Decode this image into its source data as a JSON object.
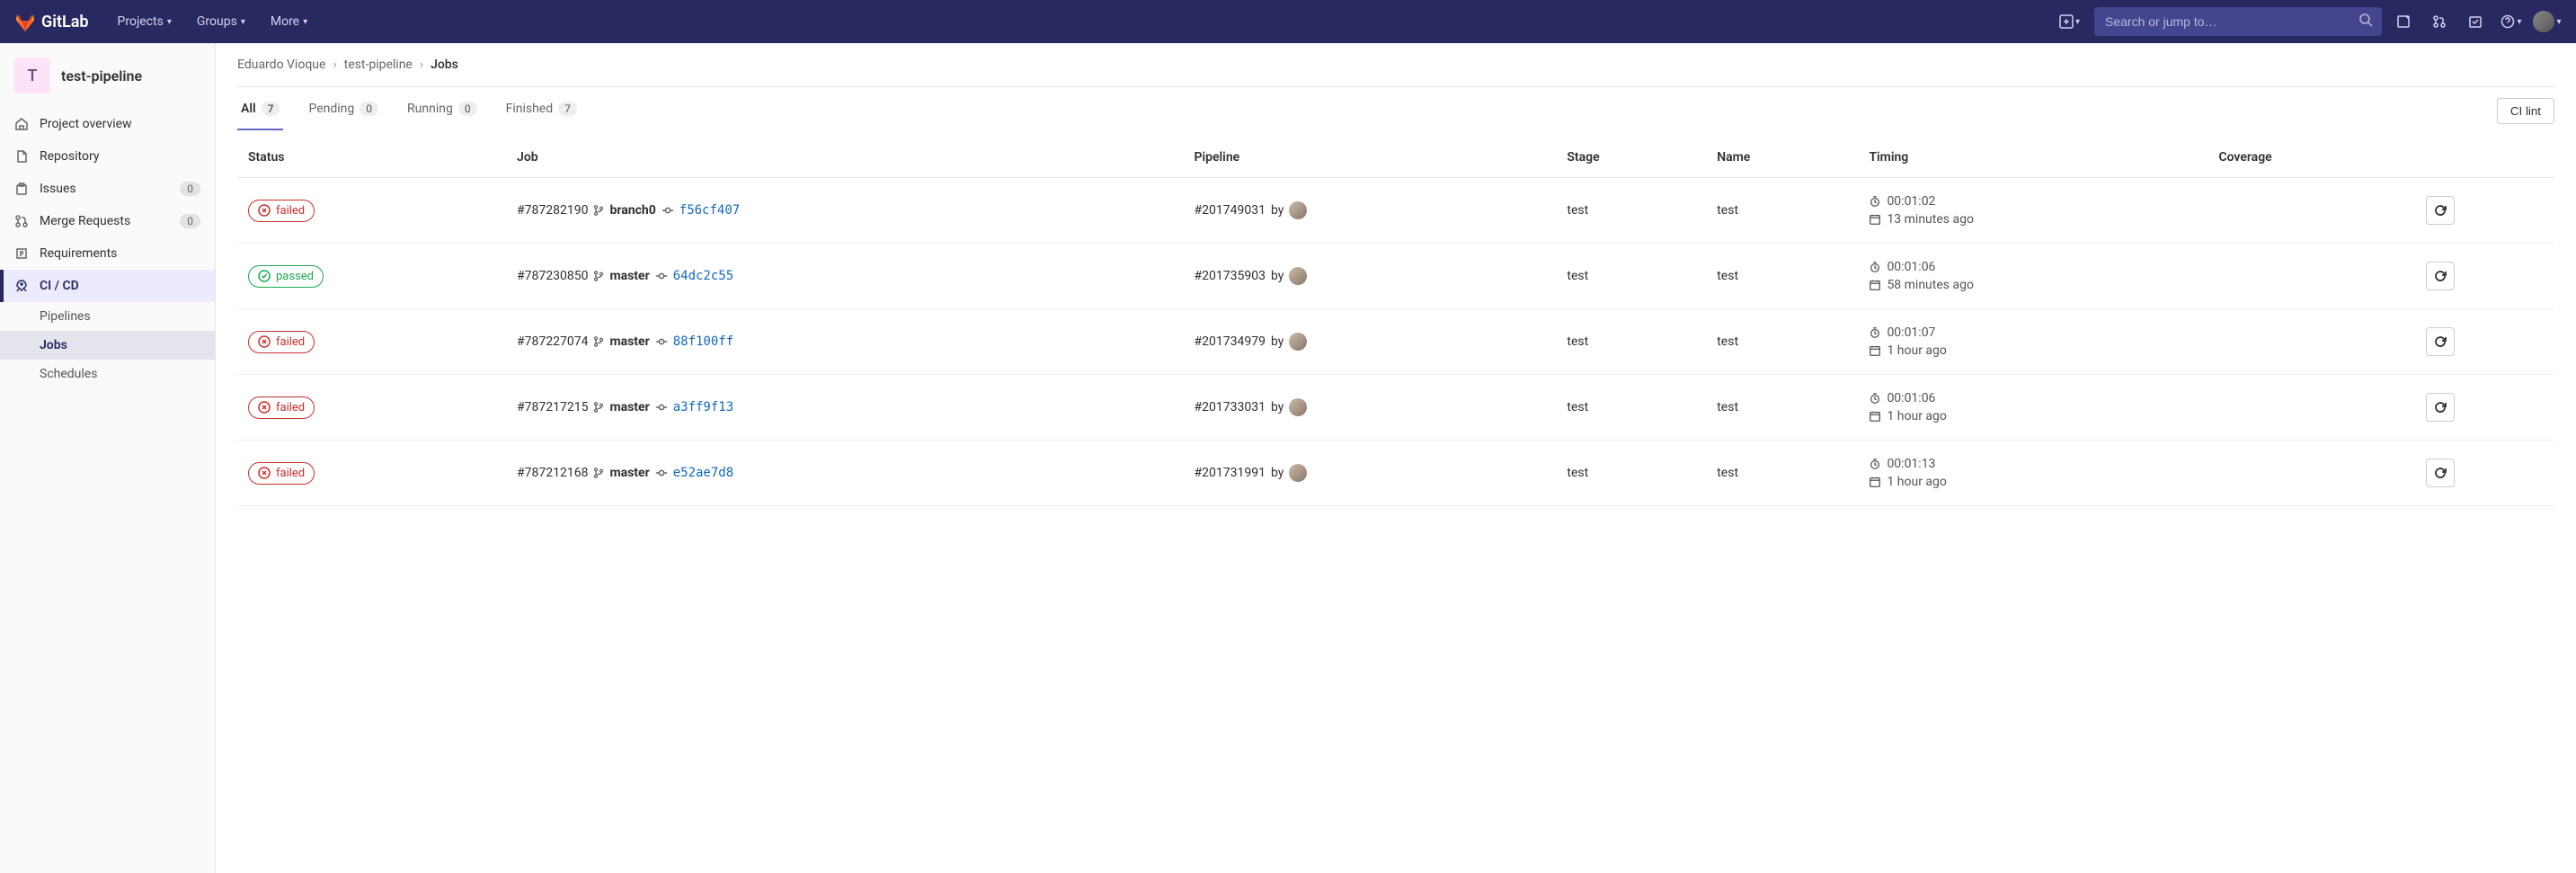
{
  "navbar": {
    "brand": "GitLab",
    "items": [
      "Projects",
      "Groups",
      "More"
    ],
    "search_placeholder": "Search or jump to…"
  },
  "sidebar": {
    "project_initial": "T",
    "project_name": "test-pipeline",
    "items": [
      {
        "label": "Project overview",
        "icon": "home"
      },
      {
        "label": "Repository",
        "icon": "doc"
      },
      {
        "label": "Issues",
        "icon": "issue",
        "badge": "0"
      },
      {
        "label": "Merge Requests",
        "icon": "merge",
        "badge": "0"
      },
      {
        "label": "Requirements",
        "icon": "req"
      },
      {
        "label": "CI / CD",
        "icon": "rocket",
        "active": true
      }
    ],
    "sub": [
      {
        "label": "Pipelines"
      },
      {
        "label": "Jobs",
        "active": true
      },
      {
        "label": "Schedules"
      }
    ]
  },
  "breadcrumb": {
    "owner": "Eduardo Vioque",
    "project": "test-pipeline",
    "current": "Jobs"
  },
  "tabs": [
    {
      "label": "All",
      "count": "7",
      "active": true
    },
    {
      "label": "Pending",
      "count": "0"
    },
    {
      "label": "Running",
      "count": "0"
    },
    {
      "label": "Finished",
      "count": "7"
    }
  ],
  "ci_lint_label": "CI lint",
  "columns": [
    "Status",
    "Job",
    "Pipeline",
    "Stage",
    "Name",
    "Timing",
    "Coverage",
    ""
  ],
  "by_text": "by",
  "jobs": [
    {
      "status": "failed",
      "job_id": "#787282190",
      "branch": "branch0",
      "sha": "f56cf407",
      "pipeline": "#201749031",
      "stage": "test",
      "name": "test",
      "duration": "00:01:02",
      "finished": "13 minutes ago"
    },
    {
      "status": "passed",
      "job_id": "#787230850",
      "branch": "master",
      "sha": "64dc2c55",
      "pipeline": "#201735903",
      "stage": "test",
      "name": "test",
      "duration": "00:01:06",
      "finished": "58 minutes ago"
    },
    {
      "status": "failed",
      "job_id": "#787227074",
      "branch": "master",
      "sha": "88f100ff",
      "pipeline": "#201734979",
      "stage": "test",
      "name": "test",
      "duration": "00:01:07",
      "finished": "1 hour ago"
    },
    {
      "status": "failed",
      "job_id": "#787217215",
      "branch": "master",
      "sha": "a3ff9f13",
      "pipeline": "#201733031",
      "stage": "test",
      "name": "test",
      "duration": "00:01:06",
      "finished": "1 hour ago"
    },
    {
      "status": "failed",
      "job_id": "#787212168",
      "branch": "master",
      "sha": "e52ae7d8",
      "pipeline": "#201731991",
      "stage": "test",
      "name": "test",
      "duration": "00:01:13",
      "finished": "1 hour ago"
    }
  ]
}
